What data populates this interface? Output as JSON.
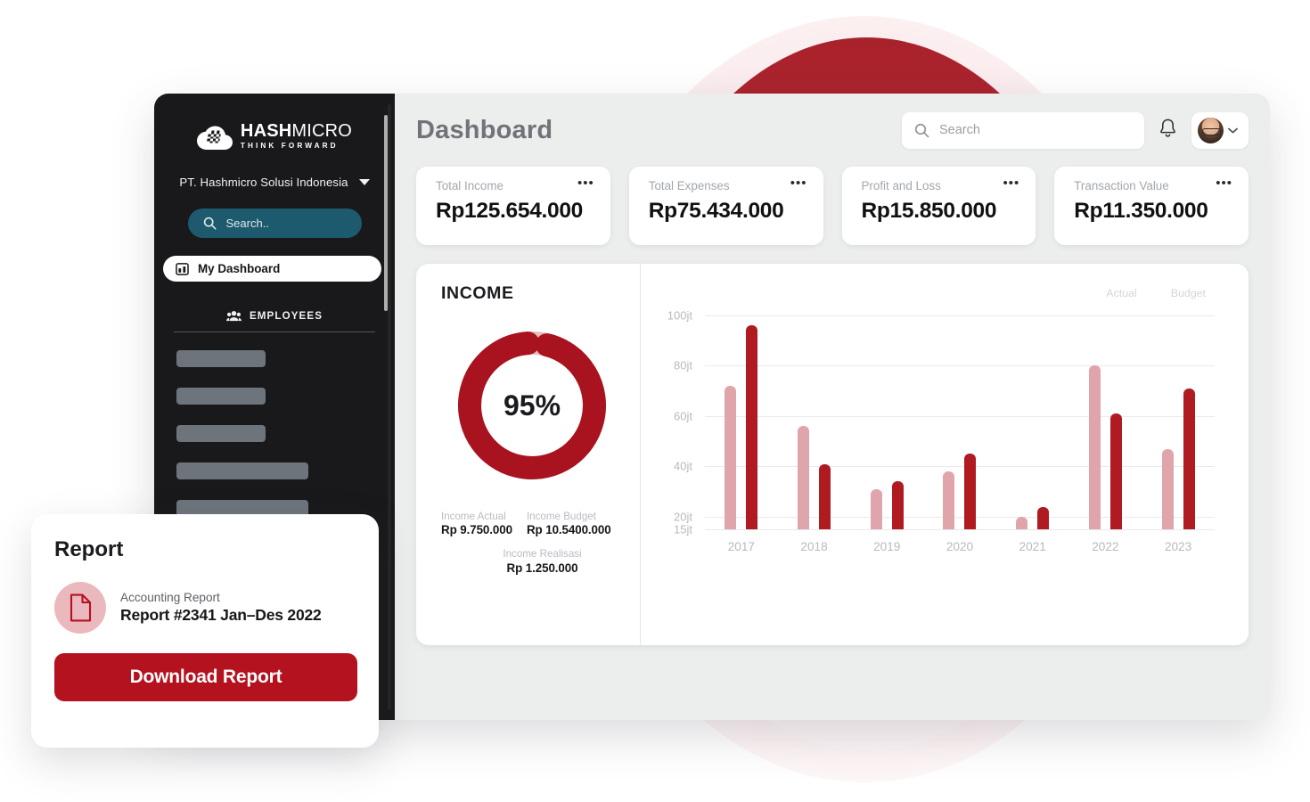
{
  "brand": {
    "logo_main_bold": "HASH",
    "logo_main_thin": "MICRO",
    "logo_tagline": "THINK FORWARD",
    "accent_red": "#b4121f",
    "accent_dark_red": "#b01b22",
    "accent_light_red": "#e0a5aa",
    "sidebar_bg": "#19191b",
    "search_teal": "#1d5a6e"
  },
  "sidebar": {
    "company": "PT. Hashmicro Solusi Indonesia",
    "company_caret_icon": "chevron-down-icon",
    "search_placeholder": "Search..",
    "search_icon": "search-icon",
    "active_item": {
      "label": "My Dashboard",
      "icon": "dashboard-icon"
    },
    "section": {
      "label": "EMPLOYEES",
      "icon": "people-icon"
    },
    "skeleton_widths": [
      "w1",
      "w1",
      "w1",
      "w2",
      "w2"
    ]
  },
  "header": {
    "title": "Dashboard",
    "search_placeholder": "Search",
    "search_icon": "search-icon",
    "bell_icon": "bell-icon",
    "avatar_icon": "avatar",
    "profile_caret_icon": "chevron-down-icon"
  },
  "kpis": [
    {
      "label": "Total Income",
      "value": "Rp125.654.000",
      "menu": "•••"
    },
    {
      "label": "Total Expenses",
      "value": "Rp75.434.000",
      "menu": "•••"
    },
    {
      "label": "Profit and Loss",
      "value": "Rp15.850.000",
      "menu": "•••"
    },
    {
      "label": "Transaction Value",
      "value": "Rp11.350.000",
      "menu": "•••"
    }
  ],
  "income": {
    "title": "INCOME",
    "percent_label": "95%",
    "percent_value": 95,
    "legend": [
      {
        "caption": "Income Actual",
        "value": "Rp 9.750.000"
      },
      {
        "caption": "Income Budget",
        "value": "Rp 10.5400.000"
      },
      {
        "caption": "Income Realisasi",
        "value": "Rp 1.250.000"
      }
    ]
  },
  "chart_data": {
    "type": "bar",
    "title": "INCOME",
    "xlabel": "",
    "ylabel": "",
    "categories": [
      "2017",
      "2018",
      "2019",
      "2020",
      "2021",
      "2022",
      "2023"
    ],
    "series": [
      {
        "name": "Actual",
        "color": "#e0a5aa",
        "values": [
          72,
          56,
          31,
          38,
          20,
          80,
          47
        ]
      },
      {
        "name": "Budget",
        "color": "#b01b22",
        "values": [
          96,
          41,
          34,
          45,
          24,
          61,
          71
        ]
      }
    ],
    "ytick_labels": [
      "100jt",
      "80jt",
      "60jt",
      "40jt",
      "20jt",
      "15jt"
    ],
    "ytick_values": [
      100,
      80,
      60,
      40,
      20,
      15
    ],
    "ylim": [
      15,
      100
    ],
    "grid": true,
    "legend_position": "top-right"
  },
  "report": {
    "title": "Report",
    "doc_icon": "document-icon",
    "meta_label": "Accounting Report",
    "meta_value": "Report #2341 Jan–Des 2022",
    "button_label": "Download Report"
  }
}
